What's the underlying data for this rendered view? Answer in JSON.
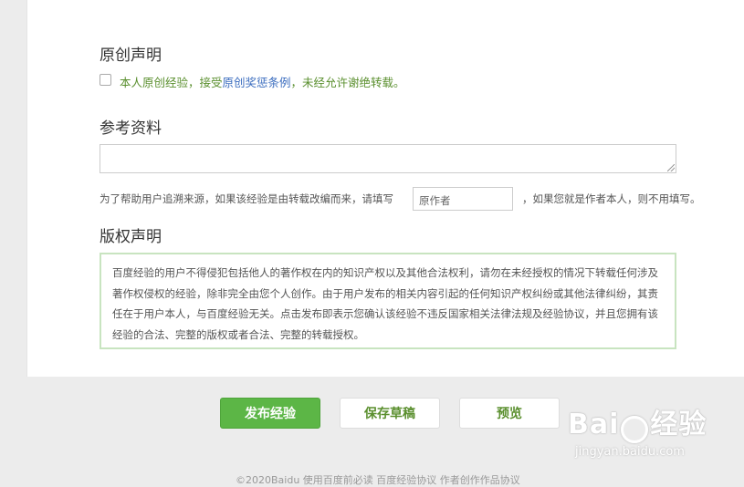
{
  "original": {
    "title": "原创声明",
    "statement_prefix": "本人原创经验，接受",
    "statement_link": "原创奖惩条例",
    "statement_suffix": "，未经允许谢绝转载。"
  },
  "reference": {
    "title": "参考资料",
    "hint_before": "为了帮助用户追溯来源，如果该经验是由转载改编而来，请填写",
    "author_placeholder": "原作者",
    "hint_after": "，如果您就是作者本人，则不用填写。"
  },
  "copyright": {
    "title": "版权声明",
    "text": "百度经验的用户不得侵犯包括他人的著作权在内的知识产权以及其他合法权利，请勿在未经授权的情况下转载任何涉及著作权侵权的经验，除非完全由您个人创作。由于用户发布的相关内容引起的任何知识产权纠纷或其他法律纠纷，其责任在于用户本人，与百度经验无关。点击发布即表示您确认该经验不违反国家相关法律法规及经验协议，并且您拥有该经验的合法、完整的版权或者合法、完整的转载授权。"
  },
  "buttons": {
    "publish": "发布经验",
    "save_draft": "保存草稿",
    "preview": "预览"
  },
  "footer": {
    "text": "©2020Baidu  使用百度前必读  百度经验协议  作者创作作品协议"
  },
  "watermark": {
    "brand": "Bai",
    "brand2": "经验",
    "url": "jingyan.baidu.com"
  },
  "colors": {
    "accent_green": "#5cb646",
    "link_blue": "#3b6dbf",
    "box_border": "#c8e4c0"
  }
}
